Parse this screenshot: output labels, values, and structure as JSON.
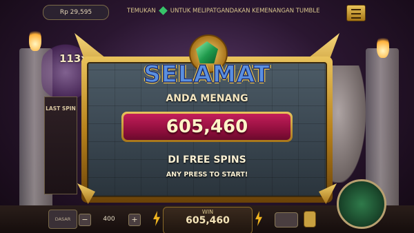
{
  "header": {
    "balance": "Rp 29,595",
    "ticker_left": "TEMUKAN",
    "ticker_right": "UNTUK MELIPATGANDAKAN KEMENANGAN TUMBLE"
  },
  "side_panel": {
    "multiplier": "113x",
    "last_spin_label": "LAST SPIN"
  },
  "popup": {
    "title": "SELAMAT",
    "subtitle": "ANDA MENANG",
    "amount": "605,460",
    "free_spins_text": "DI FREE SPINS",
    "prompt": "ANY PRESS TO START!"
  },
  "footer": {
    "bet_label": "DASAR",
    "bet_value": "400",
    "minus_symbol": "−",
    "plus_symbol": "+",
    "win_label": "WIN",
    "win_value": "605,460"
  },
  "colors": {
    "gold": "#e9c35c",
    "amount_red": "#c31e5a",
    "emerald": "#1f9a4c",
    "panel_slate": "#4c5b66"
  },
  "icons": [
    "menu-icon",
    "emerald-gem-icon",
    "lightning-bolt-icon",
    "spin-icon"
  ]
}
